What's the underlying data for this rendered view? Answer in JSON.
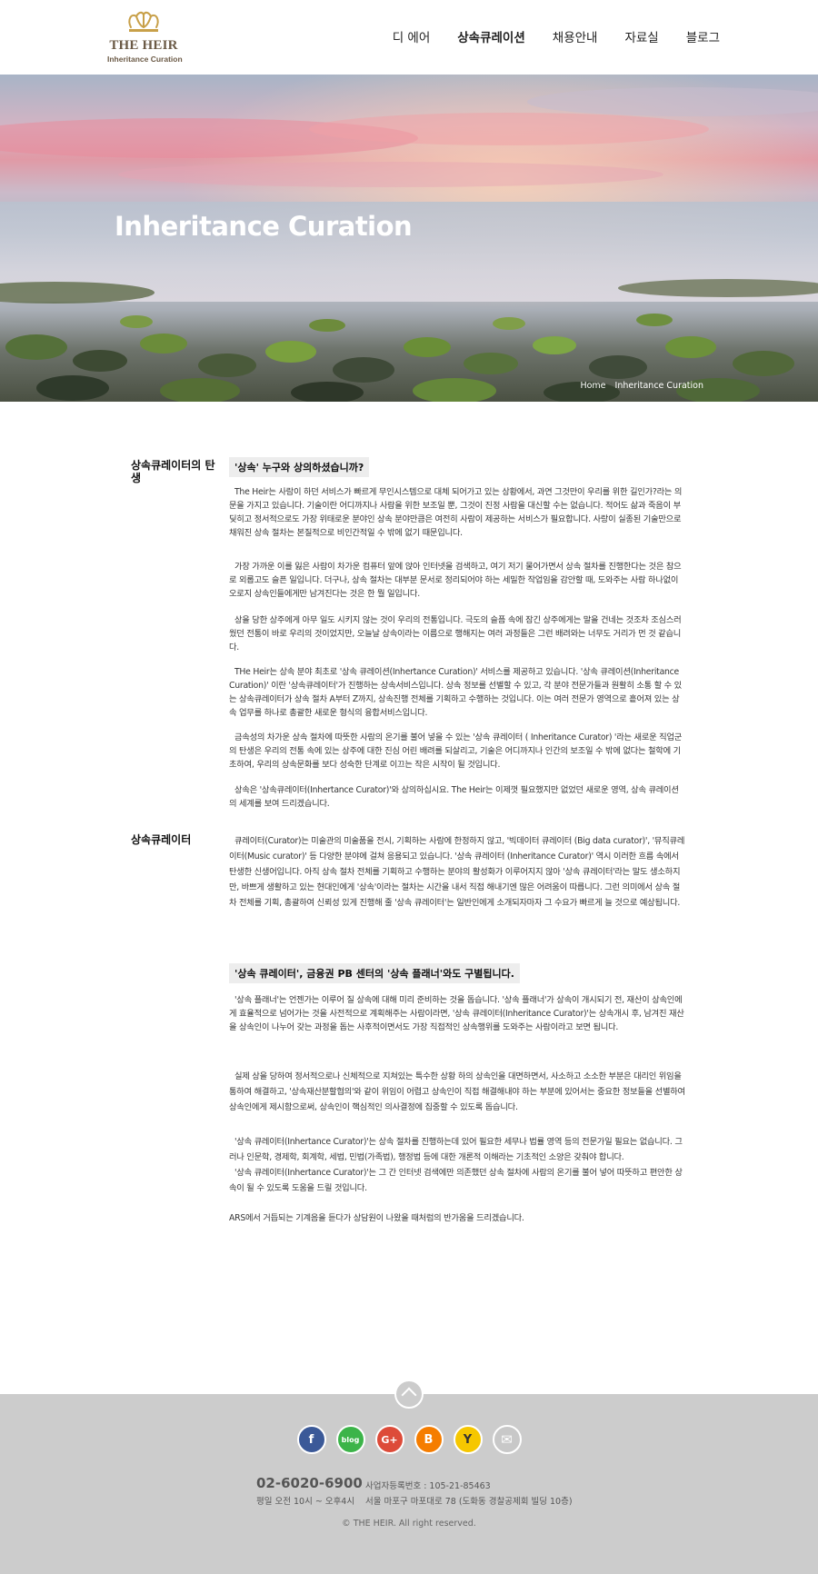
{
  "logo": {
    "main": "THE HEIR",
    "sub": "Inheritance Curation"
  },
  "nav": [
    {
      "label": "디 에어"
    },
    {
      "label": "상속큐레이션"
    },
    {
      "label": "채용안내"
    },
    {
      "label": "자료실"
    },
    {
      "label": "블로그"
    }
  ],
  "hero": {
    "title": "Inheritance Curation",
    "breadcrumb_home": "Home",
    "breadcrumb_current": "Inheritance Curation"
  },
  "section1": {
    "label": "상속큐레이터의 탄생",
    "headline": "'상속' 누구와 상의하셨습니까?",
    "paragraphs": [
      "The Heir는 사람이 하던 서비스가 빠르게 무인시스템으로 대체 되어가고 있는 상황에서, 과연 그것만이 우리를 위한 길인가?라는 의문을 가지고 있습니다. 기술이란 어디까지나 사람을 위한 보조일 뿐, 그것이 진정 사람을 대신할 수는 없습니다. 적어도 삶과 죽음이 부딪히고 정서적으로도 가장 위태로운 분야인 상속 분야만큼은 여전히 사람이 제공하는 서비스가 필요합니다. 사랑이 실종된 기술만으로 채워진 상속 절차는 본질적으로 비인간적일 수 밖에 없기 때문입니다.",
      "가장 가까운 이를 잃은 사람이 차가운 컴퓨터 앞에 앉아 인터넷을 검색하고, 여기 저기 물어가면서 상속 절차를 진행한다는 것은 참으로 외롭고도 슬픈 일입니다. 더구나, 상속 절차는 대부분 문서로 정리되어야 하는 세밀한 작업임을 감안할 때, 도와주는 사람 하나없이 오로지 상속인들에게만 남겨진다는 것은 한 뭘 일입니다.",
      "상을 당한 상주에게 아무 일도 시키지 않는 것이 우리의 전통입니다. 극도의 슬픔 속에 잠긴 상주에게는 말을 건네는 것조차 조심스러웠던 전통이 바로 우리의 것이었지만, 오늘날 상속이라는 이름으로 행해지는 여러 과정들은 그런 배려와는 너무도 거리가 먼 것 같습니다.",
      "THe Heir는 상속 분야 최초로 '상속 큐레이션(Inhertance Curation)' 서비스를 제공하고 있습니다. '상속 큐레이션(Inheritance Curation)' 이란 '상속큐레이터'가 진행하는 상속서비스입니다. 상속 정보를 선별할 수 있고, 각 분야 전문가들과 원활히 소통 할 수 있는 상속큐레이터가 상속 절차 A부터 Z까지, 상속진행 전체를 기획하고 수행하는 것입니다. 이는 여러 전문가 영역으로 흩어져 있는 상속 업무를 하나로 총괄한 새로운 형식의 융합서비스입니다.",
      "금속성의 차가운 상속 절차에 따뜻한 사람의 온기를 불어 넣을 수 있는 '상속 큐레이터 ( Inheritance Curator) '라는 새로운 직업군의 탄생은 우리의 전통 속에 있는 상주에 대한 진심 어린 배려를 되살리고, 기술은 어디까지나 인간의 보조일 수 밖에 없다는 철학에 기초하여, 우리의 상속문화를 보다 성숙한 단계로 이끄는 작은 시작이 될 것입니다.",
      "상속은 '상속큐레이터(Inhertance Curator)'와 상의하십시요.  The Heir는 이제껏 필요했지만 없었던 새로운 영역, 상속 큐레이션의 세계를 보여 드리겠습니다."
    ]
  },
  "section2": {
    "label": "상속큐레이터",
    "intro": "큐레이터(Curator)는 미술관의 미술품을 전시, 기획하는 사람에 한정하지 않고, '빅데이터 큐레이터 (Big data curator)', '뮤직큐레이터(Music curator)' 등 다양한 분야에 걸쳐 응용되고 있습니다. '상속 큐레이터 (Inheritance Curator)' 역시 이러한 흐름 속에서 탄생한 신생어입니다.  아직 상속 절차 전체를 기획하고 수행하는 분야의 활성화가 이루어지지 않아 '상속 큐레이터'라는 말도 생소하지만, 바쁘게 생활하고 있는 현대인에게 '상속'이라는 절차는 시간을 내서 직접 해내기엔 많은 어려움이 따릅니다.  그런 의미에서 상속 절차 전체를 기획, 총괄하여 신뢰성 있게 진행해 줄 '상속 큐레이터'는 일반인에게 소개되자마자 그 수요가 빠르게 늘 것으로 예상됩니다.",
    "headline": "'상속 큐레이터', 금융권 PB 센터의 '상속 플래너'와도 구별됩니다.",
    "paragraphs": [
      "'상속 플래너'는 언젠가는 이루어 질 상속에 대해 미리 준비하는 것을 돕습니다. '상속 플래너'가 상속이 개시되기 전,  재산이 상속인에게 효율적으로 넘어가는 것을 사전적으로 계획해주는 사람이라면, '상속 큐레이터(Inheritance Curator)'는 상속개시 후, 남겨진 재산을 상속인이 나누어 갖는 과정을 돕는 사후적이면서도 가장 직접적인 상속행위를 도와주는 사람이라고 보면 됩니다.",
      "실제 상을 당하여 정서적으로나 신체적으로 지쳐있는 특수한 상황 하의 상속인을 대면하면서, 사소하고 소소한 부분은 대리인 위임을 통하여 해결하고, '상속재산분할협의'와 같이 위임이 어렵고 상속인이 직접 해결해내야 하는 부분에 있어서는 중요한 정보들을 선별하여 상속인에게 제시함으로써, 상속인이  핵심적인 의사결정에 집중할 수 있도록 돕습니다.",
      "'상속 큐레이터(Inhertance Curator)'는 상속 절차를 진행하는데 있어 필요한 세무나 법률 영역 등의 전문가일 필요는 없습니다. 그러나 인문학, 경제학, 회계학, 세법, 민법(가족법), 행정법 등에 대한 개론적 이해라는 기초적인 소양은 갖춰야 합니다.",
      "'상속 큐레이터(Inhertance Curator)'는 그 간 인터넷 검색에만 의존했던 상속 절차에 사람의 온기를 불어 넣어 따뜻하고 편안한 상속이 될 수 있도록 도움을 드릴 것입니다.",
      "ARS에서 거듭되는 기계음을 듣다가 상담원이 나왔을 때처럼의 반가움을 드리겠습니다."
    ]
  },
  "footer": {
    "social": [
      {
        "icon": "facebook-icon",
        "glyph": "f",
        "color": "#3b5998"
      },
      {
        "icon": "naver-blog-icon",
        "glyph": "blog",
        "color": "#3cb449"
      },
      {
        "icon": "google-plus-icon",
        "glyph": "G+",
        "color": "#dd4b39"
      },
      {
        "icon": "blogger-icon",
        "glyph": "B",
        "color": "#f57d00"
      },
      {
        "icon": "yellow-id-icon",
        "glyph": "Y",
        "color": "#f6c700"
      },
      {
        "icon": "mail-icon",
        "glyph": "✉",
        "color": "#c8c8c8"
      }
    ],
    "phone": "02-6020-6900",
    "hours": "평일 오전 10시 ~ 오후4시",
    "biz_no": "사업자등록번호 : 105-21-85463",
    "address": "서울 마포구 마포대로 78 (도화동 경찰공제회 빌딩 10층)",
    "copyright": "© THE HEIR. All right reserved."
  }
}
